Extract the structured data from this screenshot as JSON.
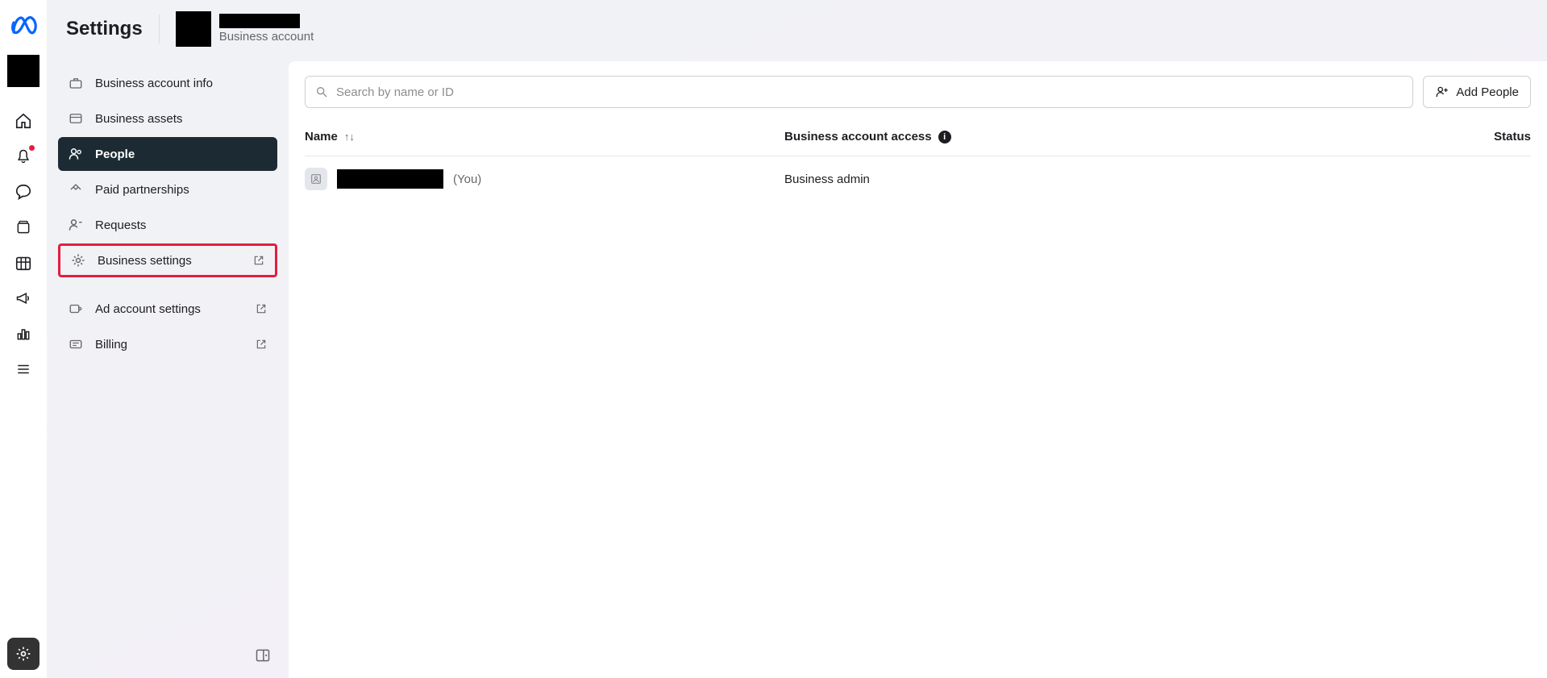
{
  "header": {
    "title": "Settings",
    "account_label": "Business account"
  },
  "sidebar": {
    "items": [
      {
        "label": "Business account info"
      },
      {
        "label": "Business assets"
      },
      {
        "label": "People"
      },
      {
        "label": "Paid partnerships"
      },
      {
        "label": "Requests"
      },
      {
        "label": "Business settings"
      },
      {
        "label": "Ad account settings"
      },
      {
        "label": "Billing"
      }
    ]
  },
  "content": {
    "search_placeholder": "Search by name or ID",
    "add_people_label": "Add People",
    "columns": {
      "name": "Name",
      "access": "Business account access",
      "status": "Status"
    },
    "rows": [
      {
        "you_suffix": "(You)",
        "access": "Business admin",
        "status": ""
      }
    ]
  }
}
